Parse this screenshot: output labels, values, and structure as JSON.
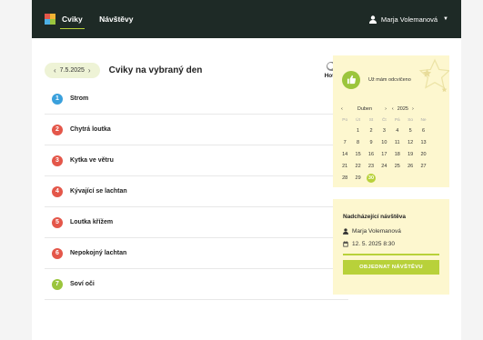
{
  "nav": {
    "items": [
      {
        "label": "Cviky",
        "active": true
      },
      {
        "label": "Návštěvy",
        "active": false
      }
    ]
  },
  "user": {
    "name": "Marja Volemanová"
  },
  "header": {
    "date": "7.5.2025",
    "prev": "‹",
    "next": "›",
    "title": "Cviky na vybraný den",
    "toggle_label": "Hotovo"
  },
  "exercises": [
    {
      "n": "1",
      "name": "Strom",
      "color": "#3aa0dc"
    },
    {
      "n": "2",
      "name": "Chytrá loutka",
      "color": "#e4574a"
    },
    {
      "n": "3",
      "name": "Kytka ve větru",
      "color": "#e4574a"
    },
    {
      "n": "4",
      "name": "Kývající se lachtan",
      "color": "#e4574a"
    },
    {
      "n": "5",
      "name": "Loutka křížem",
      "color": "#e4574a"
    },
    {
      "n": "6",
      "name": "Nepokojný lachtan",
      "color": "#e4574a"
    },
    {
      "n": "7",
      "name": "Soví oči",
      "color": "#9bc53d"
    }
  ],
  "done_panel": {
    "text": "Už mám odcvičeno"
  },
  "calendar": {
    "month": "Duben",
    "year": "2025",
    "prev": "‹",
    "next": "›",
    "weekdays": [
      "Po",
      "Út",
      "St",
      "Čt",
      "Pá",
      "So",
      "Ne"
    ],
    "days": [
      "",
      "1",
      "2",
      "3",
      "4",
      "5",
      "6",
      "7",
      "8",
      "9",
      "10",
      "11",
      "12",
      "13",
      "14",
      "15",
      "16",
      "17",
      "18",
      "19",
      "20",
      "21",
      "22",
      "23",
      "24",
      "25",
      "26",
      "27",
      "28",
      "29",
      "30"
    ],
    "selected": "30"
  },
  "visit": {
    "title": "Nadcházející návštěva",
    "person": "Marja Volemanová",
    "datetime": "12. 5. 2025 8:30",
    "button": "OBJEDNAT NÁVŠTĚVU"
  }
}
